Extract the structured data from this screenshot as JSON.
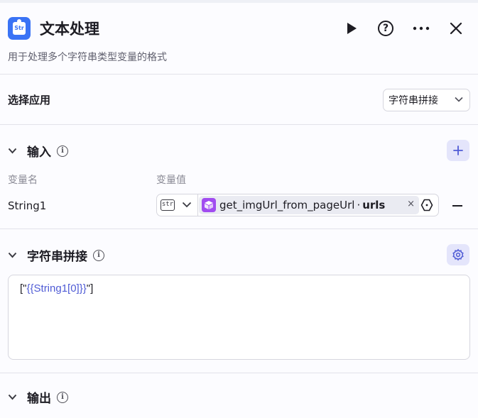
{
  "header": {
    "icon_text": "Str",
    "title": "文本处理",
    "subtitle": "用于处理多个字符串类型变量的格式"
  },
  "select_app": {
    "label": "选择应用",
    "value": "字符串拼接"
  },
  "input": {
    "title": "输入",
    "columns": {
      "name": "变量名",
      "value": "变量值"
    },
    "rows": [
      {
        "name": "String1",
        "type": "str",
        "ref_node": "get_imgUrl_from_pageUrl",
        "ref_sep": "·",
        "ref_var": "urls",
        "remove": "×"
      }
    ]
  },
  "concat": {
    "title": "字符串拼接",
    "template_prefix": "[\"",
    "template_ref": "{{String1[0]}}",
    "template_suffix": "\"]"
  },
  "output": {
    "title": "输出"
  },
  "colors": {
    "brand": "#3a73f5",
    "accent_button_bg": "#e4e5fb",
    "accent": "#4f5bd5",
    "node_icon": "#a14cf0"
  }
}
